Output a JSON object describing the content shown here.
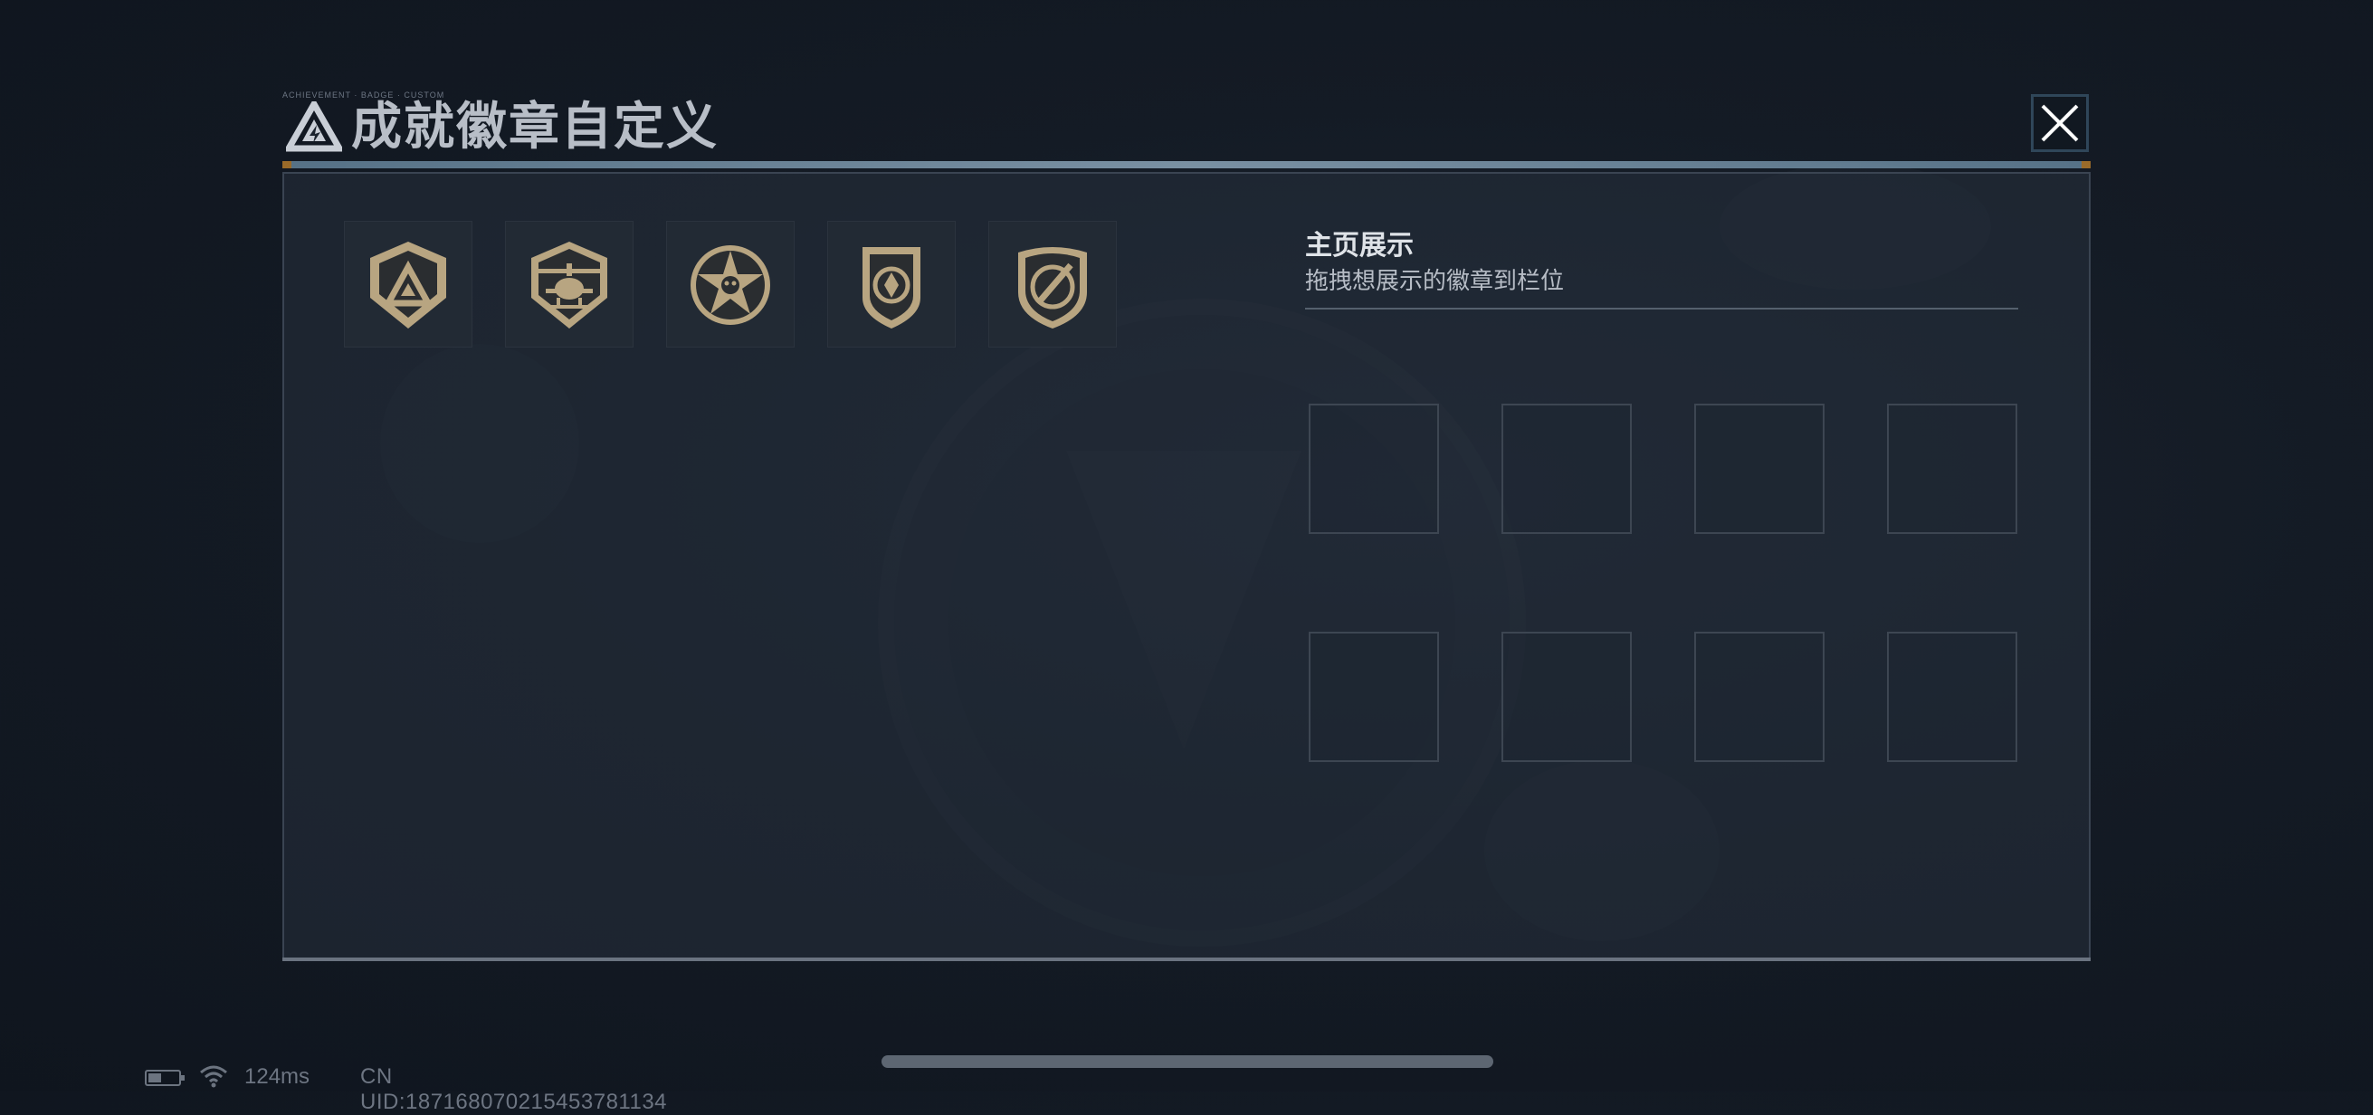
{
  "header": {
    "title": "成就徽章自定义",
    "deco_text": "ACHIEVEMENT · BADGE · CUSTOM",
    "close_icon": "close-icon"
  },
  "badges": [
    {
      "name": "peak-shield-badge",
      "icon": "mountain-triangle-icon"
    },
    {
      "name": "helicopter-badge",
      "icon": "helicopter-icon"
    },
    {
      "name": "star-skull-badge",
      "icon": "star-skull-icon"
    },
    {
      "name": "arrow-crest-badge",
      "icon": "arrow-crest-icon"
    },
    {
      "name": "blade-crest-badge",
      "icon": "blade-crest-icon"
    }
  ],
  "display": {
    "title": "主页展示",
    "subtitle": "拖拽想展示的徽章到栏位",
    "slot_count": 8
  },
  "status": {
    "ping": "124ms",
    "uid": "CN UID:187168070215453781134"
  },
  "colors": {
    "badge_gold": "#b8a581",
    "badge_dark": "#2a2d30",
    "accent_line": "#9bb7cc",
    "accent_orange": "#c8862c"
  }
}
